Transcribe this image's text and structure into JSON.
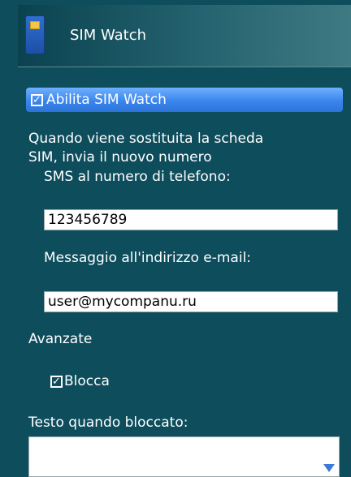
{
  "header": {
    "title": "SIM Watch",
    "icon": "sim-card-icon"
  },
  "enable": {
    "label": "Abilita SIM Watch",
    "checked": true
  },
  "description": {
    "line1": "Quando viene sostituita la scheda",
    "line2": "SIM, invia il nuovo numero"
  },
  "sms": {
    "label": "SMS al numero di telefono:",
    "value": "123456789"
  },
  "email": {
    "label": "Messaggio all'indirizzo e-mail:",
    "value": "user@mycompanu.ru"
  },
  "advanced": {
    "label": "Avanzate"
  },
  "lock": {
    "label": "Blocca",
    "checked": true
  },
  "lock_text": {
    "label": "Testo quando bloccato:",
    "value": ""
  },
  "colors": {
    "background": "#0e4d5c",
    "highlight": "#3a86ee",
    "chip": "#f3c646"
  }
}
